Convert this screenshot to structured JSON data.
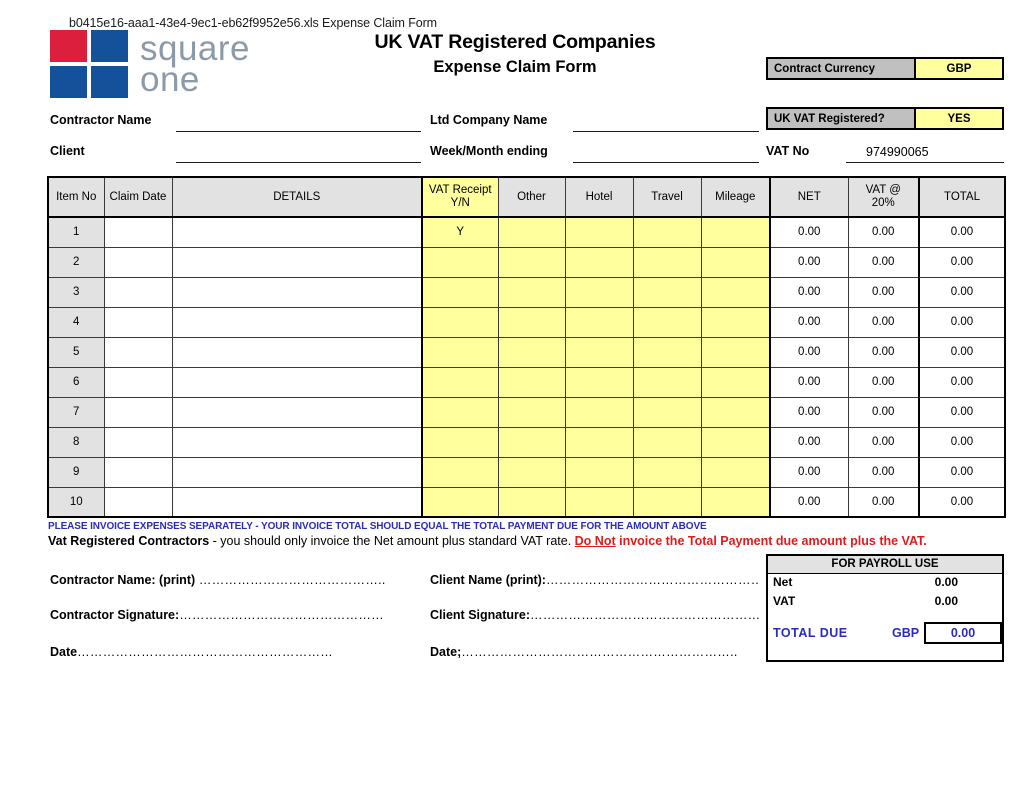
{
  "file_header": "b0415e16-aaa1-43e4-9ec1-eb62f9952e56.xls Expense Claim Form",
  "logo": {
    "word_line1": "square",
    "word_line2": "one",
    "colors": {
      "red": "#dc1f3c",
      "blue": "#15509b",
      "wordmark": "#8b9aa8"
    }
  },
  "titles": {
    "line1": "UK VAT Registered Companies",
    "line2": "Expense Claim Form"
  },
  "top_boxes": [
    {
      "label": "Contract Currency",
      "value": "GBP"
    },
    {
      "label": "UK VAT Registered?",
      "value": "YES"
    }
  ],
  "form_fields": {
    "contractor_name": {
      "label": "Contractor Name",
      "value": ""
    },
    "client": {
      "label": "Client",
      "value": ""
    },
    "ltd_company_name": {
      "label": "Ltd Company Name",
      "value": ""
    },
    "week_month_ending": {
      "label": "Week/Month ending",
      "value": ""
    },
    "vat_no": {
      "label": "VAT No",
      "value": "974990065"
    }
  },
  "table": {
    "headers": {
      "item_no": "Item No",
      "claim_date": "Claim Date",
      "details": "DETAILS",
      "vat_receipt": "VAT Receipt\nY/N",
      "vat_receipt_l1": "VAT Receipt",
      "vat_receipt_l2": "Y/N",
      "other": "Other",
      "hotel": "Hotel",
      "travel": "Travel",
      "mileage": "Mileage",
      "net": "NET",
      "vat_l1": "VAT @",
      "vat_l2": "20%",
      "total": "TOTAL"
    },
    "rows": [
      {
        "item_no": "1",
        "claim_date": "",
        "details": "",
        "vat_receipt": "Y",
        "other": "",
        "hotel": "",
        "travel": "",
        "mileage": "",
        "net": "0.00",
        "vat": "0.00",
        "total": "0.00"
      },
      {
        "item_no": "2",
        "claim_date": "",
        "details": "",
        "vat_receipt": "",
        "other": "",
        "hotel": "",
        "travel": "",
        "mileage": "",
        "net": "0.00",
        "vat": "0.00",
        "total": "0.00"
      },
      {
        "item_no": "3",
        "claim_date": "",
        "details": "",
        "vat_receipt": "",
        "other": "",
        "hotel": "",
        "travel": "",
        "mileage": "",
        "net": "0.00",
        "vat": "0.00",
        "total": "0.00"
      },
      {
        "item_no": "4",
        "claim_date": "",
        "details": "",
        "vat_receipt": "",
        "other": "",
        "hotel": "",
        "travel": "",
        "mileage": "",
        "net": "0.00",
        "vat": "0.00",
        "total": "0.00"
      },
      {
        "item_no": "5",
        "claim_date": "",
        "details": "",
        "vat_receipt": "",
        "other": "",
        "hotel": "",
        "travel": "",
        "mileage": "",
        "net": "0.00",
        "vat": "0.00",
        "total": "0.00"
      },
      {
        "item_no": "6",
        "claim_date": "",
        "details": "",
        "vat_receipt": "",
        "other": "",
        "hotel": "",
        "travel": "",
        "mileage": "",
        "net": "0.00",
        "vat": "0.00",
        "total": "0.00"
      },
      {
        "item_no": "7",
        "claim_date": "",
        "details": "",
        "vat_receipt": "",
        "other": "",
        "hotel": "",
        "travel": "",
        "mileage": "",
        "net": "0.00",
        "vat": "0.00",
        "total": "0.00"
      },
      {
        "item_no": "8",
        "claim_date": "",
        "details": "",
        "vat_receipt": "",
        "other": "",
        "hotel": "",
        "travel": "",
        "mileage": "",
        "net": "0.00",
        "vat": "0.00",
        "total": "0.00"
      },
      {
        "item_no": "9",
        "claim_date": "",
        "details": "",
        "vat_receipt": "",
        "other": "",
        "hotel": "",
        "travel": "",
        "mileage": "",
        "net": "0.00",
        "vat": "0.00",
        "total": "0.00"
      },
      {
        "item_no": "10",
        "claim_date": "",
        "details": "",
        "vat_receipt": "",
        "other": "",
        "hotel": "",
        "travel": "",
        "mileage": "",
        "net": "0.00",
        "vat": "0.00",
        "total": "0.00"
      }
    ]
  },
  "notes": {
    "blue_line": "PLEASE INVOICE EXPENSES SEPARATELY - YOUR INVOICE TOTAL SHOULD EQUAL THE TOTAL PAYMENT DUE FOR THE AMOUNT ABOVE",
    "line2_bold": "Vat Registered Contractors",
    "line2_plain": " - you should only invoice the Net amount plus standard VAT rate. ",
    "line2_red_underline": "Do Not",
    "line2_red": " invoice the Total Payment due amount plus the VAT."
  },
  "signatures": {
    "contractor_name_print": "Contractor Name: (print)",
    "contractor_name_dots": " ……………………………………..",
    "contractor_signature": "Contractor Signature:",
    "contractor_signature_dots": "…………………………………………",
    "date_left": "Date",
    "date_left_dots": "……………………………………………………",
    "client_name_print": "Client Name (print):",
    "client_name_dots": "……………………………………………",
    "client_signature": "Client Signature:",
    "client_signature_dots": "…………………………………………………….",
    "date_right": "Date;",
    "date_right_dots": "……………………………………………………….."
  },
  "payroll": {
    "header": "FOR PAYROLL USE",
    "net_label": "Net",
    "net_value": "0.00",
    "vat_label": "VAT",
    "vat_value": "0.00",
    "total_due_label": "TOTAL  DUE",
    "currency": "GBP",
    "total_due_value": "0.00",
    "accent_color": "#2b2bbf"
  }
}
